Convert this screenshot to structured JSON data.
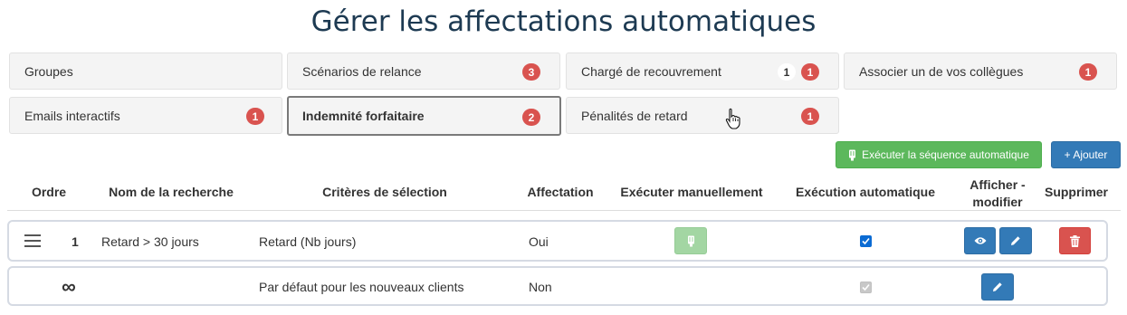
{
  "page": {
    "title": "Gérer les affectations automatiques"
  },
  "tabs": [
    {
      "label": "Groupes"
    },
    {
      "label": "Scénarios de relance",
      "badge": "3"
    },
    {
      "label": "Chargé de recouvrement",
      "count": "1",
      "badge": "1"
    },
    {
      "label": "Associer un de vos collègues",
      "badge": "1"
    },
    {
      "label": "Emails interactifs",
      "badge": "1"
    },
    {
      "label": "Indemnité forfaitaire",
      "badge": "2",
      "active": true
    },
    {
      "label": "Pénalités de retard",
      "badge": "1"
    }
  ],
  "actions": {
    "run_sequence_label": "Exécuter la séquence automatique",
    "add_label": "+ Ajouter"
  },
  "table": {
    "headers": {
      "order": "Ordre",
      "search_name": "Nom de la recherche",
      "criteria": "Critères de sélection",
      "assignment": "Affectation",
      "run_manually": "Exécuter manuellement",
      "auto_execution": "Exécution automatique",
      "view_edit_line1": "Afficher -",
      "view_edit_line2": "modifier",
      "delete": "Supprimer"
    },
    "rows": [
      {
        "order": "1",
        "name": "Retard > 30 jours",
        "criteria": "Retard (Nb jours)",
        "assignment": "Oui",
        "auto": true
      },
      {
        "order": "∞",
        "name": "",
        "criteria": "Par défaut pour les nouveaux clients",
        "assignment": "Non",
        "auto": true,
        "auto_disabled": true
      }
    ]
  },
  "icons": {
    "drag": "drag-handle-icon",
    "run": "device-icon",
    "view": "eye-icon",
    "edit": "pencil-icon",
    "delete": "trash-icon",
    "pointer": "hand-pointer-icon"
  },
  "colors": {
    "badge": "#d9534f",
    "primary": "#337ab7",
    "success": "#5cb85c",
    "danger": "#d9534f",
    "title": "#1d3a52"
  }
}
